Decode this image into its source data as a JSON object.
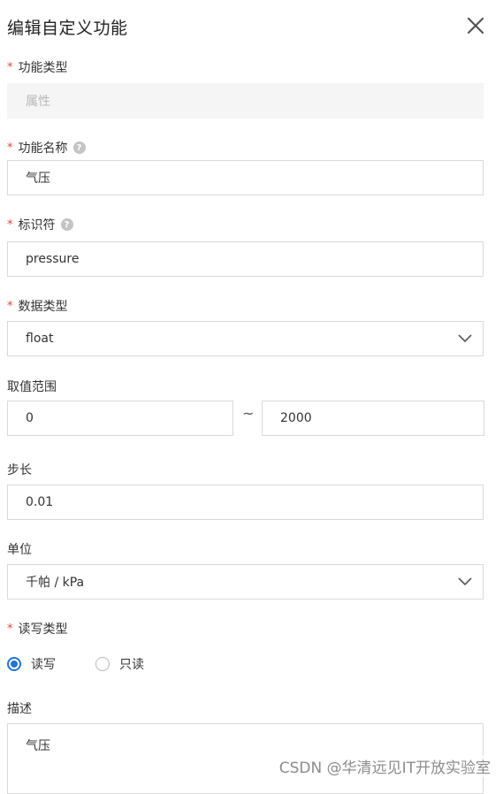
{
  "dialog": {
    "title": "编辑自定义功能",
    "close_icon": "close-icon"
  },
  "fields": {
    "function_type": {
      "label": "功能类型",
      "required": "*",
      "value": "属性"
    },
    "function_name": {
      "label": "功能名称",
      "required": "*",
      "help": "?",
      "value": "气压"
    },
    "identifier": {
      "label": "标识符",
      "required": "*",
      "help": "?",
      "value": "pressure"
    },
    "data_type": {
      "label": "数据类型",
      "required": "*",
      "value": "float"
    },
    "value_range": {
      "label": "取值范围",
      "min": "0",
      "separator": "~",
      "max": "2000"
    },
    "step": {
      "label": "步长",
      "value": "0.01"
    },
    "unit": {
      "label": "单位",
      "value": "千帕 / kPa"
    },
    "rw_type": {
      "label": "读写类型",
      "required": "*",
      "options": [
        "读写",
        "只读"
      ],
      "selected": "读写"
    },
    "description": {
      "label": "描述",
      "value": "气压"
    }
  },
  "watermark": "CSDN @华清远见IT开放实验室",
  "colors": {
    "accent": "#1f73e0",
    "required": "#e8453c",
    "border": "#d9d9d9"
  }
}
